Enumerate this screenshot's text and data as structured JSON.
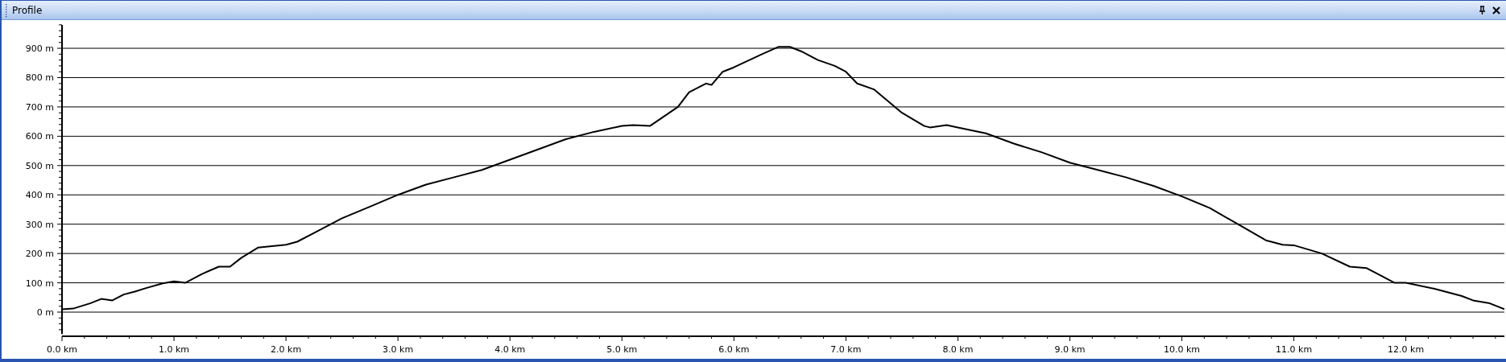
{
  "window": {
    "title": "Profile"
  },
  "chart": {
    "chart_data": {
      "type": "line",
      "x": [
        0,
        0.1,
        0.25,
        0.35,
        0.45,
        0.55,
        0.65,
        0.75,
        0.9,
        1.0,
        1.1,
        1.25,
        1.4,
        1.5,
        1.6,
        1.75,
        2.0,
        2.1,
        2.25,
        2.5,
        2.75,
        3.0,
        3.25,
        3.5,
        3.75,
        4.0,
        4.25,
        4.5,
        4.75,
        5.0,
        5.1,
        5.25,
        5.5,
        5.6,
        5.75,
        5.8,
        5.9,
        6.0,
        6.25,
        6.4,
        6.5,
        6.6,
        6.75,
        6.9,
        7.0,
        7.1,
        7.25,
        7.5,
        7.7,
        7.75,
        7.9,
        8.0,
        8.25,
        8.5,
        8.75,
        9.0,
        9.25,
        9.5,
        9.75,
        10.0,
        10.25,
        10.5,
        10.75,
        10.9,
        11.0,
        11.25,
        11.5,
        11.65,
        11.75,
        11.9,
        12.0,
        12.25,
        12.5,
        12.6,
        12.75,
        12.88
      ],
      "series": [
        {
          "color": "#000000",
          "values": [
            10,
            12,
            30,
            45,
            40,
            60,
            70,
            82,
            98,
            105,
            100,
            130,
            155,
            155,
            185,
            220,
            230,
            240,
            270,
            320,
            360,
            400,
            435,
            460,
            485,
            520,
            555,
            590,
            615,
            635,
            638,
            635,
            700,
            750,
            780,
            775,
            820,
            835,
            880,
            905,
            905,
            890,
            860,
            840,
            820,
            780,
            760,
            680,
            635,
            630,
            638,
            630,
            610,
            575,
            545,
            510,
            485,
            460,
            430,
            395,
            355,
            300,
            245,
            230,
            228,
            200,
            155,
            150,
            130,
            100,
            100,
            80,
            55,
            40,
            30,
            10
          ]
        }
      ],
      "grid": true,
      "xlim": [
        0,
        12.88
      ],
      "ylim": [
        -75,
        980
      ],
      "xticks": [
        {
          "value": 0,
          "label": "0.0 km"
        },
        {
          "value": 1,
          "label": "1.0 km"
        },
        {
          "value": 2,
          "label": "2.0 km"
        },
        {
          "value": 3,
          "label": "3.0 km"
        },
        {
          "value": 4,
          "label": "4.0 km"
        },
        {
          "value": 5,
          "label": "5.0 km"
        },
        {
          "value": 6,
          "label": "6.0 km"
        },
        {
          "value": 7,
          "label": "7.0 km"
        },
        {
          "value": 8,
          "label": "8.0 km"
        },
        {
          "value": 9,
          "label": "9.0 km"
        },
        {
          "value": 10,
          "label": "10.0 km"
        },
        {
          "value": 11,
          "label": "11.0 km"
        },
        {
          "value": 12,
          "label": "12.0 km"
        }
      ],
      "yticks": [
        {
          "value": 0,
          "label": "0 m"
        },
        {
          "value": 100,
          "label": "100 m"
        },
        {
          "value": 200,
          "label": "200 m"
        },
        {
          "value": 300,
          "label": "300 m"
        },
        {
          "value": 400,
          "label": "400 m"
        },
        {
          "value": 500,
          "label": "500 m"
        },
        {
          "value": 600,
          "label": "600 m"
        },
        {
          "value": 700,
          "label": "700 m"
        },
        {
          "value": 800,
          "label": "800 m"
        },
        {
          "value": 900,
          "label": "900 m"
        }
      ]
    }
  }
}
